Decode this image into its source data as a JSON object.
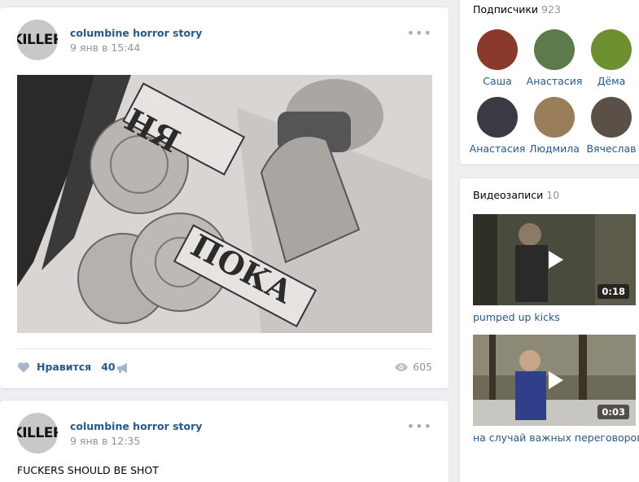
{
  "posts": [
    {
      "author": "columbine horror story",
      "avatar_text": "KILLER",
      "date": "9 янв в 15:44",
      "image_text": [
        "НЯ",
        "ПОКА"
      ],
      "like_label": "Нравится",
      "likes": "40",
      "views": "605"
    },
    {
      "author": "columbine horror story",
      "avatar_text": "KILLER",
      "date": "9 янв в 12:35",
      "text": "FUCKERS SHOULD BE SHOT"
    }
  ],
  "more_glyph": "•••",
  "subscribers": {
    "title": "Подписчики",
    "count": "923",
    "items": [
      {
        "name": "Саша",
        "color": "#8a3a2a"
      },
      {
        "name": "Анастасия",
        "color": "#5c7a4a"
      },
      {
        "name": "Дёма",
        "color": "#6d8f2f"
      },
      {
        "name": "Анастасия",
        "color": "#3a3a45"
      },
      {
        "name": "Людмила",
        "color": "#9a7d5a"
      },
      {
        "name": "Вячеслав",
        "color": "#5a5048"
      }
    ]
  },
  "videos": {
    "title": "Видеозаписи",
    "count": "10",
    "items": [
      {
        "title": "pumped up kicks",
        "duration": "0:18"
      },
      {
        "title": "на случай важных переговоров",
        "duration": "0:03"
      }
    ]
  },
  "icons": {
    "heart": "heart-icon",
    "share": "megaphone-icon",
    "views": "eye-icon",
    "play": "play-icon"
  },
  "colors": {
    "link": "#2a5885",
    "muted": "#939393",
    "background": "#edeef0"
  }
}
